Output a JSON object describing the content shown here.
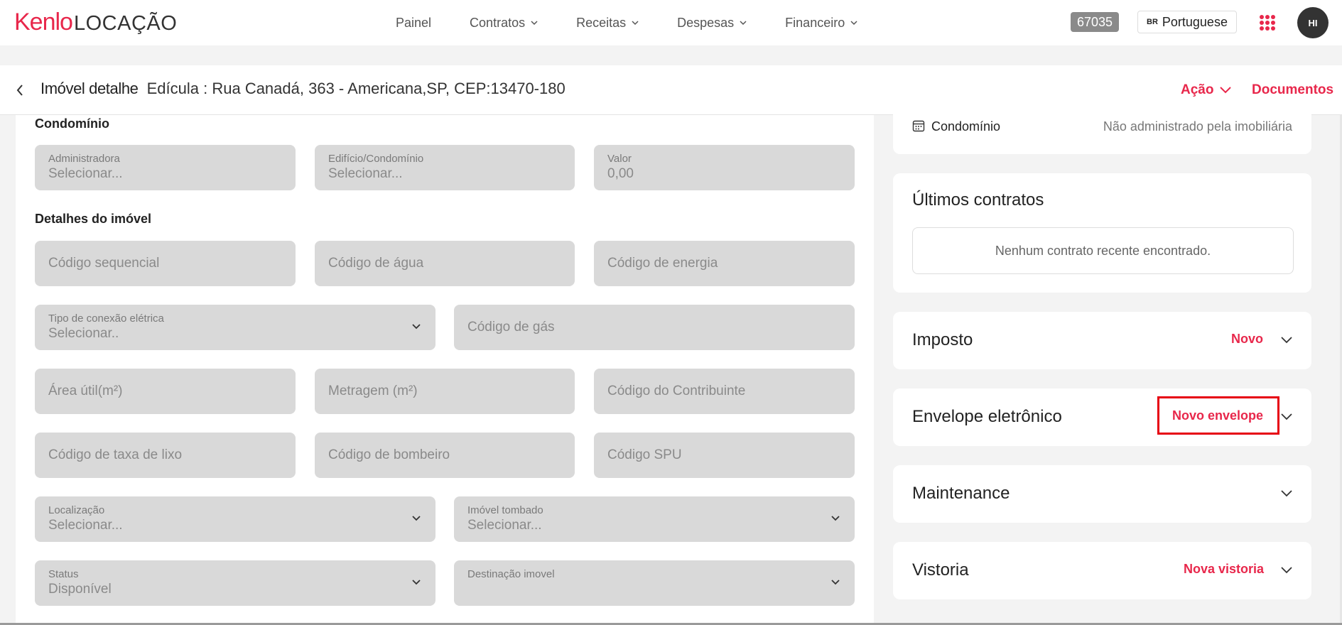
{
  "brand": {
    "name": "Kenlo",
    "product": "LOCAÇÃO",
    "accent": "#e8274b"
  },
  "nav": {
    "items": [
      {
        "label": "Painel",
        "dropdown": false
      },
      {
        "label": "Contratos",
        "dropdown": true
      },
      {
        "label": "Receitas",
        "dropdown": true
      },
      {
        "label": "Despesas",
        "dropdown": true
      },
      {
        "label": "Financeiro",
        "dropdown": true
      }
    ],
    "badge": "67035",
    "language": {
      "flag": "BR",
      "label": "Portuguese"
    },
    "avatar": "HI"
  },
  "header": {
    "title": "Imóvel detalhe",
    "address": "Edícula : Rua Canadá, 363 - Americana,SP, CEP:13470-180",
    "action_label": "Ação",
    "documents_label": "Documentos"
  },
  "form": {
    "condominio_title": "Condomínio",
    "condominio": {
      "administradora": {
        "label": "Administradora",
        "value": "Selecionar..."
      },
      "edificio": {
        "label": "Edifício/Condomínio",
        "value": "Selecionar..."
      },
      "valor": {
        "label": "Valor",
        "value": "0,00"
      }
    },
    "detalhes_title": "Detalhes do imóvel",
    "codigo_sequencial": "Código sequencial",
    "codigo_agua": "Código de água",
    "codigo_energia": "Código de energia",
    "tipo_conexao": {
      "label": "Tipo de conexão elétrica",
      "value": "Selecionar.."
    },
    "codigo_gas": "Código de gás",
    "area_util": "Área útil(m²)",
    "metragem": "Metragem (m²)",
    "codigo_contribuinte": "Código do Contribuinte",
    "codigo_lixo": "Código de taxa de lixo",
    "codigo_bombeiro": "Código de bombeiro",
    "codigo_spu": "Código SPU",
    "localizacao": {
      "label": "Localização",
      "value": "Selecionar..."
    },
    "imovel_tombado": {
      "label": "Imóvel tombado",
      "value": "Selecionar..."
    },
    "status": {
      "label": "Status",
      "value": "Disponível"
    },
    "destinacao": {
      "label": "Destinação imovel",
      "value": ""
    }
  },
  "sidebar": {
    "condominio_row": {
      "label": "Condomínio",
      "value": "Não administrado pela imobiliária"
    },
    "ultimos_contratos": {
      "title": "Últimos contratos",
      "empty": "Nenhum contrato recente encontrado."
    },
    "imposto": {
      "title": "Imposto",
      "action": "Novo"
    },
    "envelope": {
      "title": "Envelope eletrônico",
      "action": "Novo envelope"
    },
    "maintenance": {
      "title": "Maintenance"
    },
    "vistoria": {
      "title": "Vistoria",
      "action": "Nova vistoria"
    }
  }
}
